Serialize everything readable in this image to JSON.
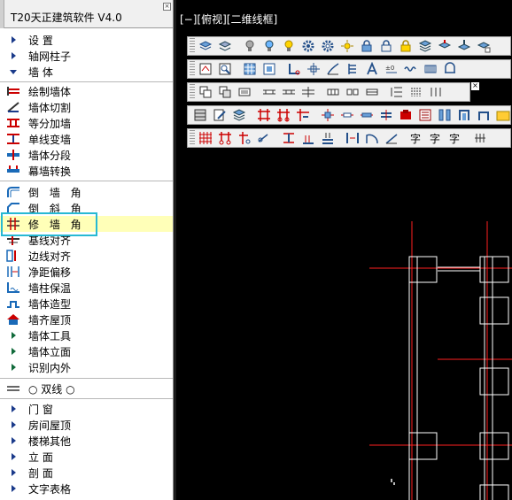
{
  "app": {
    "title": "T20天正建筑软件 V4.0"
  },
  "menu": {
    "top_groups": [
      {
        "label": "设    置"
      },
      {
        "label": "轴网柱子"
      },
      {
        "label": "墙    体"
      }
    ],
    "wall_tools": [
      {
        "label": "绘制墙体",
        "icon": "draw-wall-icon"
      },
      {
        "label": "墙体切割",
        "icon": "wall-cut-icon"
      },
      {
        "label": "等分加墙",
        "icon": "divide-add-wall-icon"
      },
      {
        "label": "单线变墙",
        "icon": "line-to-wall-icon"
      },
      {
        "label": "墙体分段",
        "icon": "wall-segment-icon"
      },
      {
        "label": "幕墙转换",
        "icon": "curtain-wall-icon"
      }
    ],
    "corner_tools": [
      {
        "label": "倒 墙 角",
        "icon": "fillet-wall-icon"
      },
      {
        "label": "倒 斜 角",
        "icon": "chamfer-wall-icon"
      },
      {
        "label": "修 墙 角",
        "icon": "fix-corner-icon",
        "active": true
      },
      {
        "label": "基线对齐",
        "icon": "baseline-align-icon"
      },
      {
        "label": "边线对齐",
        "icon": "edge-align-icon"
      },
      {
        "label": "净距偏移",
        "icon": "offset-icon"
      },
      {
        "label": "墙柱保温",
        "icon": "insulation-icon"
      },
      {
        "label": "墙体造型",
        "icon": "wall-shape-icon"
      },
      {
        "label": "墙齐屋顶",
        "icon": "wall-roof-icon"
      }
    ],
    "sub_groups": [
      {
        "label": "墙体工具"
      },
      {
        "label": "墙体立面"
      },
      {
        "label": "识别内外"
      }
    ],
    "double_line": {
      "label": "○ 双线 ○"
    },
    "bottom_groups": [
      {
        "label": "门    窗"
      },
      {
        "label": "房间屋顶"
      },
      {
        "label": "楼梯其他"
      },
      {
        "label": "立    面"
      },
      {
        "label": "剖    面"
      },
      {
        "label": "文字表格"
      }
    ]
  },
  "viewport": {
    "label": "[−][俯视][二维线框]"
  },
  "colors": {
    "panel_bg": "#ffffff",
    "canvas_bg": "#000000",
    "highlight_bg": "#ffffb8",
    "highlight_border": "#27b9d3",
    "axis_red": "#ff2020",
    "wall_white": "#ffffff"
  },
  "toolbars": [
    {
      "icons": [
        "layers-icon",
        "layer-swap-icon",
        "bulb-icon",
        "bulb-off-icon",
        "sun-icon",
        "gear-icon",
        "gear-alt-icon",
        "light-icon",
        "lock-icon",
        "unlock-icon",
        "lock-color-icon",
        "layer-stack-icon",
        "layer-merge-icon",
        "layer-down-icon",
        "layer-more-icon"
      ]
    },
    {
      "icons": [
        "snap-icon",
        "zoom-icon",
        "table-icon",
        "frame-icon",
        "axis-icon",
        "pillar-icon",
        "stairs-icon",
        "column-icon",
        "text-A-icon",
        "dim-icon",
        "wave-icon",
        "grid-pattern-icon",
        "cable-icon"
      ]
    },
    {
      "icons": [
        "copy-icon",
        "paste-icon",
        "block-icon",
        "door-icon",
        "window-icon",
        "wall-icon",
        "window2-icon",
        "window3-icon",
        "window4-icon",
        "list-icon",
        "grid-dots-icon",
        "close-icon"
      ]
    },
    {
      "icons": [
        "table2-icon",
        "edit-icon",
        "layers2-icon",
        "grid-icon",
        "grid2-icon",
        "joint-icon",
        "cross-icon",
        "tee-icon",
        "split-icon",
        "beam-icon",
        "stamp-icon",
        "book-icon",
        "columns-icon",
        "columns2-icon",
        "folder-icon"
      ]
    },
    {
      "icons": [
        "grid-red-icon",
        "grid-red2-icon",
        "node-icon",
        "dim2-icon",
        "level-icon",
        "stair-icon",
        "stack-icon",
        "mirror-icon",
        "arc-icon",
        "radius-icon",
        "word-icon",
        "word2-icon",
        "word3-icon",
        "axis2-icon",
        "axis3-icon"
      ]
    }
  ]
}
